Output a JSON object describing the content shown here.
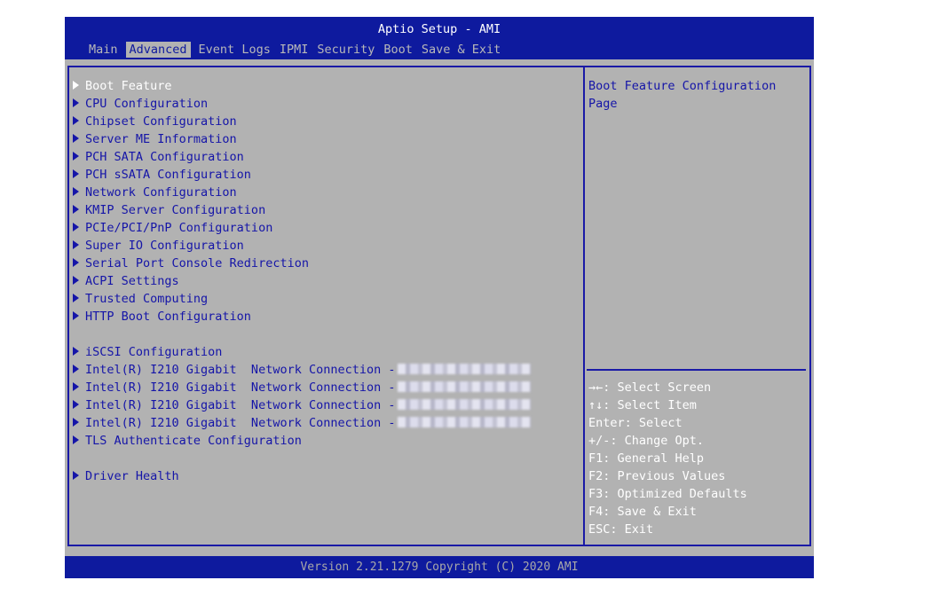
{
  "header": {
    "title": "Aptio Setup - AMI",
    "tabs": [
      {
        "label": "Main"
      },
      {
        "label": "Advanced"
      },
      {
        "label": "Event Logs"
      },
      {
        "label": "IPMI"
      },
      {
        "label": "Security"
      },
      {
        "label": "Boot"
      },
      {
        "label": "Save & Exit"
      }
    ],
    "active_tab": "Advanced"
  },
  "menu": {
    "items": [
      {
        "label": "Boot Feature"
      },
      {
        "label": "CPU Configuration"
      },
      {
        "label": "Chipset Configuration"
      },
      {
        "label": "Server ME Information"
      },
      {
        "label": "PCH SATA Configuration"
      },
      {
        "label": "PCH sSATA Configuration"
      },
      {
        "label": "Network Configuration"
      },
      {
        "label": "KMIP Server Configuration"
      },
      {
        "label": "PCIe/PCI/PnP Configuration"
      },
      {
        "label": "Super IO Configuration"
      },
      {
        "label": "Serial Port Console Redirection"
      },
      {
        "label": "ACPI Settings"
      },
      {
        "label": "Trusted Computing"
      },
      {
        "label": "HTTP Boot Configuration"
      },
      {
        "label": "iSCSI Configuration"
      },
      {
        "label": "Intel(R) I210 Gigabit  Network Connection -"
      },
      {
        "label": "Intel(R) I210 Gigabit  Network Connection -"
      },
      {
        "label": "Intel(R) I210 Gigabit  Network Connection -"
      },
      {
        "label": "Intel(R) I210 Gigabit  Network Connection -"
      },
      {
        "label": "TLS Authenticate Configuration"
      },
      {
        "label": "Driver Health"
      }
    ],
    "selected_index": 0
  },
  "help": {
    "description_line1": "Boot Feature Configuration",
    "description_line2": "Page",
    "keys": [
      {
        "text": "→←: Select Screen"
      },
      {
        "text": "↑↓: Select Item"
      },
      {
        "text": "Enter: Select"
      },
      {
        "text": "+/-: Change Opt."
      },
      {
        "text": "F1: General Help"
      },
      {
        "text": "F2: Previous Values"
      },
      {
        "text": "F3: Optimized Defaults"
      },
      {
        "text": "F4: Save & Exit"
      },
      {
        "text": "ESC: Exit"
      }
    ]
  },
  "footer": {
    "text": "Version 2.21.1279 Copyright (C) 2020 AMI"
  },
  "colors": {
    "header_blue": "#0e1a9e",
    "panel_gray": "#b2b2b2",
    "item_blue": "#1515a8",
    "selected_white": "#ffffff"
  }
}
